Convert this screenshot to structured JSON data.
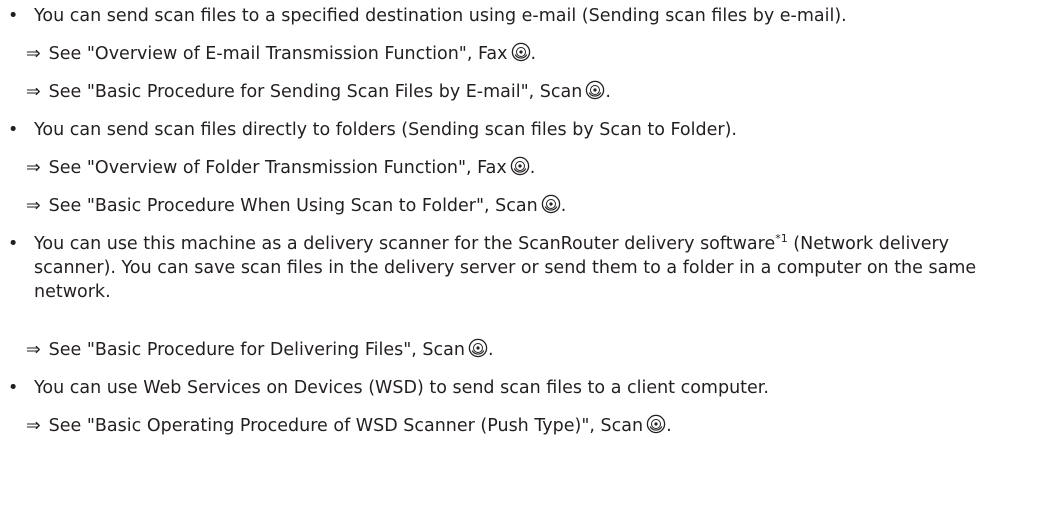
{
  "items": [
    {
      "bullet": "•",
      "text": "You can send scan files to a specified destination using e-mail (Sending scan files by e-mail).",
      "refs": [
        {
          "arrow": "⇒",
          "text": "See \"Overview of E-mail Transmission Function\", Fax",
          "icon": "cd-disc-icon"
        },
        {
          "arrow": "⇒",
          "text": "See \"Basic Procedure for Sending Scan Files by E-mail\", Scan",
          "icon": "cd-disc-icon"
        }
      ]
    },
    {
      "bullet": "•",
      "text": "You can send scan files directly to folders (Sending scan files by Scan to Folder).",
      "refs": [
        {
          "arrow": "⇒",
          "text": "See \"Overview of Folder Transmission Function\", Fax",
          "icon": "cd-disc-icon"
        },
        {
          "arrow": "⇒",
          "text": "See \"Basic Procedure When Using Scan to Folder\", Scan",
          "icon": "cd-disc-icon"
        }
      ]
    },
    {
      "bullet": "•",
      "text_before": "You can use this machine as a delivery scanner for the ScanRouter delivery software",
      "footnote": "*1",
      "text_after": " (Network delivery scanner). You can save scan files in the delivery server or send them to a folder in a computer on the same network.",
      "refs": [
        {
          "arrow": "⇒",
          "text": "See \"Basic Procedure for Delivering Files\", Scan",
          "icon": "cd-disc-icon"
        }
      ]
    },
    {
      "bullet": "•",
      "text": "You can use Web Services on Devices (WSD) to send scan files to a client computer.",
      "refs": [
        {
          "arrow": "⇒",
          "text": "See \"Basic Operating Procedure of WSD Scanner (Push Type)\", Scan",
          "icon": "cd-disc-icon"
        }
      ]
    }
  ]
}
